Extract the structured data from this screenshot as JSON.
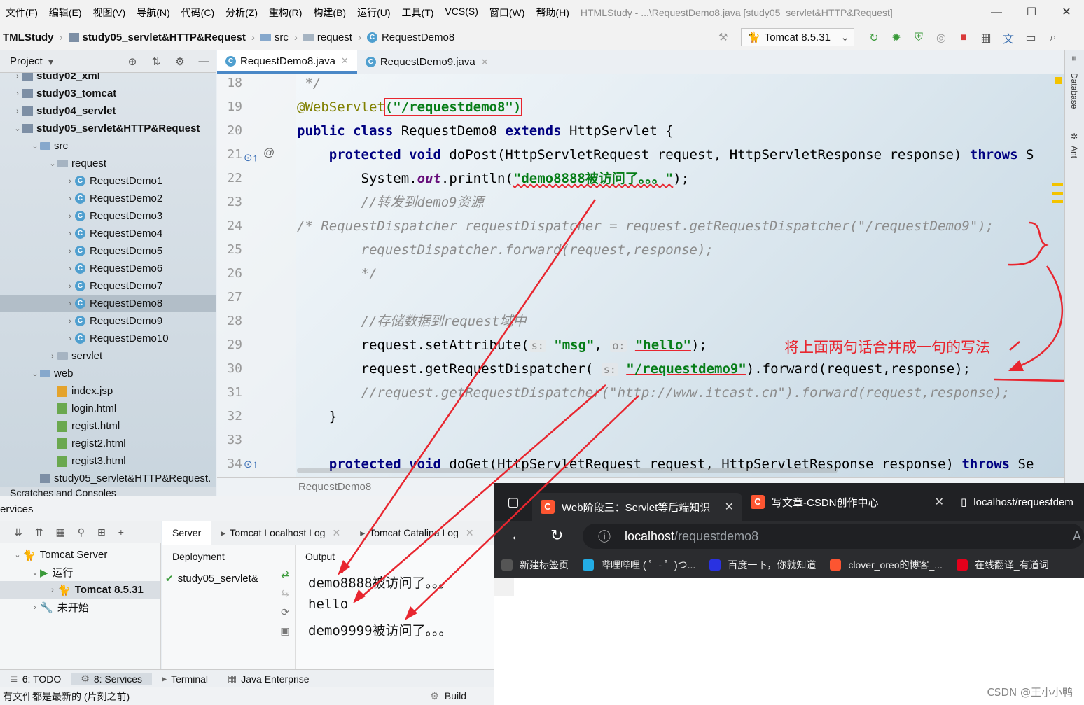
{
  "menu": [
    "文件(F)",
    "编辑(E)",
    "视图(V)",
    "导航(N)",
    "代码(C)",
    "分析(Z)",
    "重构(R)",
    "构建(B)",
    "运行(U)",
    "工具(T)",
    "VCS(S)",
    "窗口(W)",
    "帮助(H)"
  ],
  "window_title": "HTMLStudy - ...\\RequestDemo8.java [study05_servlet&HTTP&Request]",
  "breadcrumb": {
    "project": "TMLStudy",
    "module": "study05_servlet&HTTP&Request",
    "src": "src",
    "pkg": "request",
    "cls": "RequestDemo8"
  },
  "run_config": "Tomcat 8.5.31",
  "project_panel": {
    "title": "Project"
  },
  "tree": [
    {
      "label": "study02_xml",
      "depth": 0,
      "icon": "module"
    },
    {
      "label": "study03_tomcat",
      "depth": 0,
      "icon": "module"
    },
    {
      "label": "study04_servlet",
      "depth": 0,
      "icon": "module"
    },
    {
      "label": "study05_servlet&HTTP&Request",
      "depth": 0,
      "icon": "module"
    },
    {
      "label": "src",
      "depth": 1,
      "icon": "folder"
    },
    {
      "label": "request",
      "depth": 2,
      "icon": "package"
    },
    {
      "label": "RequestDemo1",
      "depth": 3,
      "icon": "class"
    },
    {
      "label": "RequestDemo2",
      "depth": 3,
      "icon": "class"
    },
    {
      "label": "RequestDemo3",
      "depth": 3,
      "icon": "class"
    },
    {
      "label": "RequestDemo4",
      "depth": 3,
      "icon": "class"
    },
    {
      "label": "RequestDemo5",
      "depth": 3,
      "icon": "class"
    },
    {
      "label": "RequestDemo6",
      "depth": 3,
      "icon": "class"
    },
    {
      "label": "RequestDemo7",
      "depth": 3,
      "icon": "class"
    },
    {
      "label": "RequestDemo8",
      "depth": 3,
      "icon": "class",
      "selected": true
    },
    {
      "label": "RequestDemo9",
      "depth": 3,
      "icon": "class"
    },
    {
      "label": "RequestDemo10",
      "depth": 3,
      "icon": "class"
    },
    {
      "label": "servlet",
      "depth": 2,
      "icon": "package"
    },
    {
      "label": "web",
      "depth": 1,
      "icon": "folder"
    },
    {
      "label": "index.jsp",
      "depth": 2,
      "icon": "jsp"
    },
    {
      "label": "login.html",
      "depth": 2,
      "icon": "html"
    },
    {
      "label": "regist.html",
      "depth": 2,
      "icon": "html"
    },
    {
      "label": "regist2.html",
      "depth": 2,
      "icon": "html"
    },
    {
      "label": "regist3.html",
      "depth": 2,
      "icon": "html"
    },
    {
      "label": "study05_servlet&HTTP&Request.",
      "depth": 1,
      "icon": "iml"
    }
  ],
  "scratches": "Scratches and Consoles",
  "editor_tabs": [
    {
      "label": "RequestDemo8.java",
      "active": true
    },
    {
      "label": "RequestDemo9.java",
      "active": false
    }
  ],
  "line_numbers": [
    "18",
    "19",
    "20",
    "21",
    "22",
    "23",
    "24",
    "25",
    "26",
    "27",
    "28",
    "29",
    "30",
    "31",
    "32",
    "33",
    "34"
  ],
  "code": {
    "l18": " */",
    "l19_ann": "@WebServlet",
    "l19_str": "(\"/requestdemo8\")",
    "l20_kw1": "public class",
    "l20_name": " RequestDemo8 ",
    "l20_kw2": "extends",
    "l20_rest": " HttpServlet {",
    "l21_kw": "    protected void",
    "l21_rest": " doPost(HttpServletRequest request, HttpServletResponse response) ",
    "l21_throws": "throws",
    "l21_tail": " S",
    "l22_a": "        System.",
    "l22_out": "out",
    "l22_b": ".println(",
    "l22_str": "\"demo8888被访问了。。。\"",
    "l22_c": ");",
    "l23": "        //转发到demo9资源",
    "l24": "/* RequestDispatcher requestDispatcher = request.getRequestDispatcher(\"/requestDemo9\");",
    "l25": "        requestDispatcher.forward(request,response);",
    "l26": "        */",
    "l28": "        //存储数据到request域中",
    "l29_a": "        request.setAttribute(",
    "l29_h1": "s:",
    "l29_s1": "\"msg\"",
    "l29_b": ", ",
    "l29_h2": "o:",
    "l29_s2": "\"hello\"",
    "l29_c": ");",
    "l30_a": "        request.getRequestDispatcher( ",
    "l30_h": "s:",
    "l30_s": "\"/requestdemo9\"",
    "l30_b": ").forward(request,response);",
    "l31_a": "        //request.getRequestDispatcher(\"",
    "l31_url": "http://www.itcast.cn",
    "l31_b": "\").forward(request,response);",
    "l32": "    }",
    "l34_kw": "    protected void",
    "l34_rest": " doGet(HttpServletRequest request, HttpServletResponse response) ",
    "l34_throws": "throws",
    "l34_tail": " Se",
    "note": "将上面两句话合并成一句的写法"
  },
  "editor_footer": "RequestDemo8",
  "right_strip": {
    "database": "Database",
    "ant": "Ant"
  },
  "services": {
    "title": "ervices",
    "tree": [
      {
        "label": "Tomcat Server",
        "depth": 0
      },
      {
        "label": "运行",
        "depth": 1
      },
      {
        "label": "Tomcat 8.5.31",
        "depth": 2,
        "bold": true
      },
      {
        "label": "未开始",
        "depth": 1
      }
    ],
    "tabs": [
      "Server",
      "Tomcat Localhost Log",
      "Tomcat Catalina Log"
    ],
    "deployment_header": "Deployment",
    "output_header": "Output",
    "deployment_item": "study05_servlet&",
    "output": [
      "demo8888被访问了。。。",
      "hello",
      "demo9999被访问了。。。"
    ]
  },
  "bottom_tabs": [
    "6: TODO",
    "8: Services",
    "Terminal",
    "Java Enterprise"
  ],
  "status": {
    "text": "有文件都是最新的 (片刻之前)",
    "build": "Build"
  },
  "browser": {
    "tabs": [
      {
        "label": "Web阶段三：Servlet等后端知识",
        "icon": "C",
        "active": true
      },
      {
        "label": "写文章-CSDN创作中心",
        "icon": "C",
        "active": false
      },
      {
        "label": "localhost/requestdem",
        "icon": "page",
        "active": false
      }
    ],
    "url_host": "localhost",
    "url_path": "/requestdemo8",
    "favorites": [
      "新建标签页",
      "哔哩哔哩 ( ゜- ゜)つ...",
      "百度一下，你就知道",
      "clover_oreo的博客_...",
      "在线翻译_有道词"
    ]
  },
  "watermark": "CSDN @王小小鸭",
  "colors": {
    "accent": "#4a88c7",
    "annotation_red": "#e8262f",
    "keyword": "#000080",
    "string": "#067d17"
  }
}
